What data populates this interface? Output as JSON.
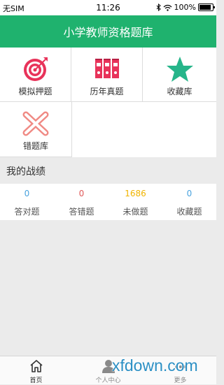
{
  "status_bar": {
    "carrier": "无SIM",
    "time": "11:26",
    "battery": "100%",
    "battery_level": 1.0
  },
  "app": {
    "title": "小学教师资格题库"
  },
  "grid": {
    "items": [
      {
        "label": "模拟押题",
        "icon": "target-icon"
      },
      {
        "label": "历年真题",
        "icon": "binders-icon"
      },
      {
        "label": "收藏库",
        "icon": "star-icon"
      },
      {
        "label": "错题库",
        "icon": "cross-icon"
      }
    ]
  },
  "record": {
    "title": "我的战绩",
    "stats": [
      {
        "value": "0",
        "label": "答对题",
        "color": "#4aa3df"
      },
      {
        "value": "0",
        "label": "答错题",
        "color": "#e05a5a"
      },
      {
        "value": "1686",
        "label": "未做题",
        "color": "#f0b400"
      },
      {
        "value": "0",
        "label": "收藏题",
        "color": "#4aa3df"
      }
    ]
  },
  "tabs": [
    {
      "label": "首页",
      "icon": "home-icon"
    },
    {
      "label": "个人中心",
      "icon": "user-icon"
    },
    {
      "label": "更多",
      "icon": "more-icon"
    }
  ],
  "watermark": "xfdown.com",
  "colors": {
    "brand": "#1fb26e",
    "target": "#e8335a",
    "star": "#26b58a",
    "cross": "#f08a84"
  }
}
